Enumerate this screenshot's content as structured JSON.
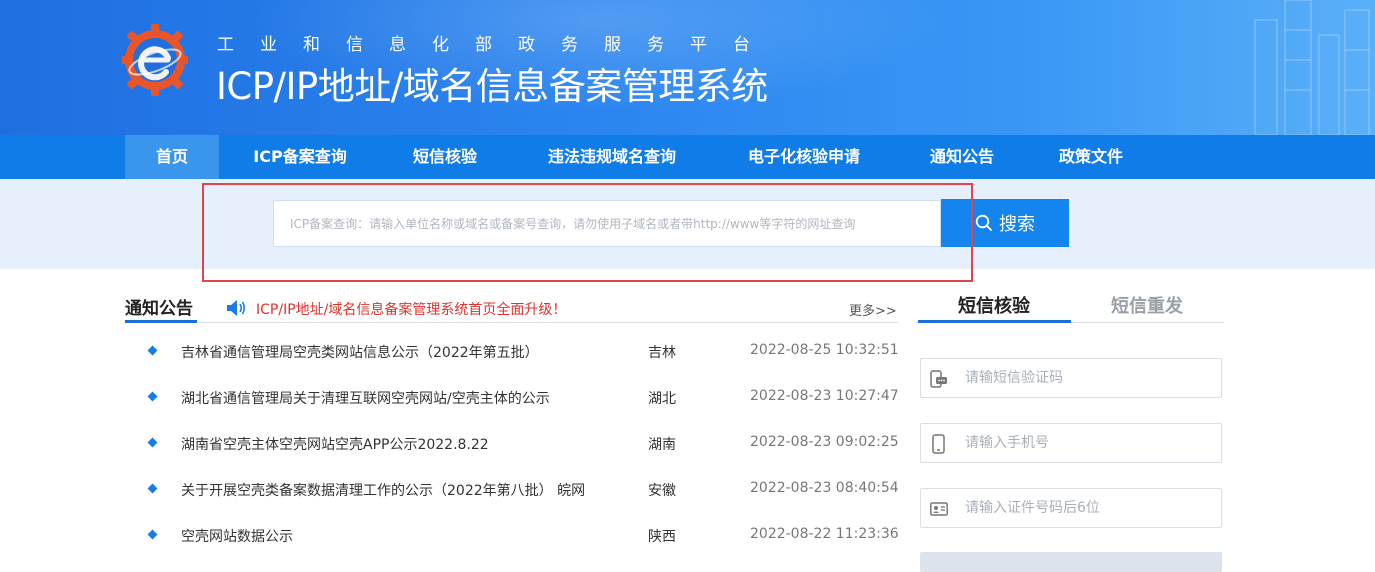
{
  "header": {
    "subtitle": "工业和信息化部政务服务平台",
    "title": "ICP/IP地址/域名信息备案管理系统"
  },
  "nav": {
    "items": [
      {
        "label": "首页",
        "active": true
      },
      {
        "label": "ICP备案查询"
      },
      {
        "label": "短信核验"
      },
      {
        "label": "违法违规域名查询"
      },
      {
        "label": "电子化核验申请"
      },
      {
        "label": "通知公告"
      },
      {
        "label": "政策文件"
      }
    ]
  },
  "search": {
    "placeholder": "ICP备案查询：请输入单位名称或域名或备案号查询，请勿使用子域名或者带http://www等字符的网址查询",
    "button_label": "搜索"
  },
  "notices": {
    "title": "通知公告",
    "marquee": "ICP/IP地址/域名信息备案管理系统首页全面升级！",
    "more": "更多>>",
    "items": [
      {
        "text": "吉林省通信管理局空壳类网站信息公示（2022年第五批）",
        "region": "吉林",
        "date": "2022-08-25 10:32:51"
      },
      {
        "text": "湖北省通信管理局关于清理互联网空壳网站/空壳主体的公示",
        "region": "湖北",
        "date": "2022-08-23 10:27:47"
      },
      {
        "text": "湖南省空壳主体空壳网站空壳APP公示2022.8.22",
        "region": "湖南",
        "date": "2022-08-23 09:02:25"
      },
      {
        "text": "关于开展空壳类备案数据清理工作的公示（2022年第八批） 皖网",
        "region": "安徽",
        "date": "2022-08-23 08:40:54"
      },
      {
        "text": "空壳网站数据公示",
        "region": "陕西",
        "date": "2022-08-22 11:23:36"
      }
    ]
  },
  "sms": {
    "tabs": [
      {
        "label": "短信核验",
        "active": true
      },
      {
        "label": "短信重发"
      }
    ],
    "fields": [
      {
        "icon": "sms-code-icon",
        "placeholder": "请输短信验证码"
      },
      {
        "icon": "mobile-phone-icon",
        "placeholder": "请输入手机号"
      },
      {
        "icon": "id-card-icon",
        "placeholder": "请输入证件号码后6位"
      }
    ]
  },
  "colors": {
    "nav_bg": "#0f7ce8",
    "nav_active": "#3a95ec",
    "search_btn": "#1485ee",
    "highlight_box": "#e4434a",
    "marquee_text": "#e0322c",
    "accent_underline": "#1a6fd8"
  }
}
